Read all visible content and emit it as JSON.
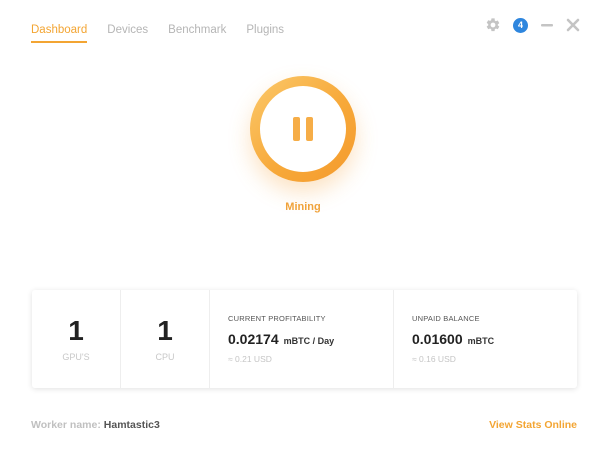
{
  "nav": {
    "tabs": [
      {
        "label": "Dashboard",
        "active": true
      },
      {
        "label": "Devices",
        "active": false
      },
      {
        "label": "Benchmark",
        "active": false
      },
      {
        "label": "Plugins",
        "active": false
      }
    ]
  },
  "window_controls": {
    "settings_icon": "gear-icon",
    "notification_count": "4",
    "minimize_icon": "minimize-icon",
    "close_icon": "close-icon"
  },
  "mining": {
    "icon": "pause-icon",
    "status": "Mining"
  },
  "stats": {
    "gpus": {
      "count": "1",
      "label": "GPU'S"
    },
    "cpu": {
      "count": "1",
      "label": "CPU"
    },
    "profitability": {
      "heading": "CURRENT PROFITABILITY",
      "amount": "0.02174",
      "unit": "mBTC / Day",
      "usd": "≈ 0.21 USD"
    },
    "balance": {
      "heading": "UNPAID BALANCE",
      "amount": "0.01600",
      "unit": "mBTC",
      "usd": "≈ 0.16 USD"
    }
  },
  "footer": {
    "worker_label": "Worker name:",
    "worker_name": "Hamtastic3",
    "view_stats": "View Stats Online"
  },
  "colors": {
    "accent": "#f3a533",
    "badge": "#2e86de",
    "muted_text": "#b5b5b5"
  }
}
